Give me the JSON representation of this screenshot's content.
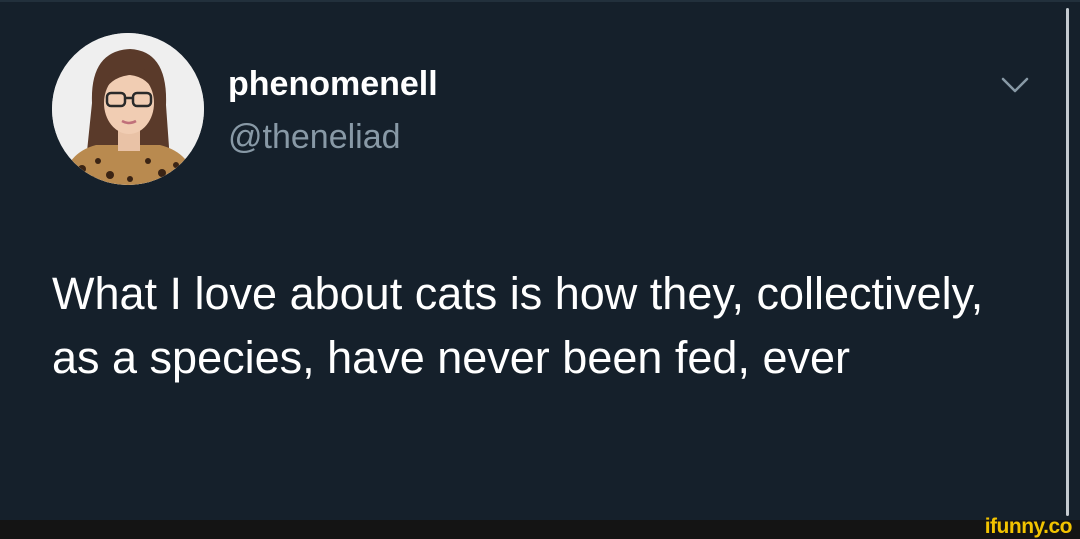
{
  "tweet": {
    "display_name": "phenomenell",
    "handle": "@theneliad",
    "text": "What I love about cats is how they, collectively, as a species, have never been fed, ever",
    "avatar_icon": "profile-photo"
  },
  "menu": {
    "icon": "chevron-down-icon"
  },
  "watermark": {
    "text": "ifunny.co"
  },
  "colors": {
    "background": "#15202b",
    "primary_text": "#ffffff",
    "secondary_text": "#8899a6",
    "watermark": "#f2c300"
  }
}
